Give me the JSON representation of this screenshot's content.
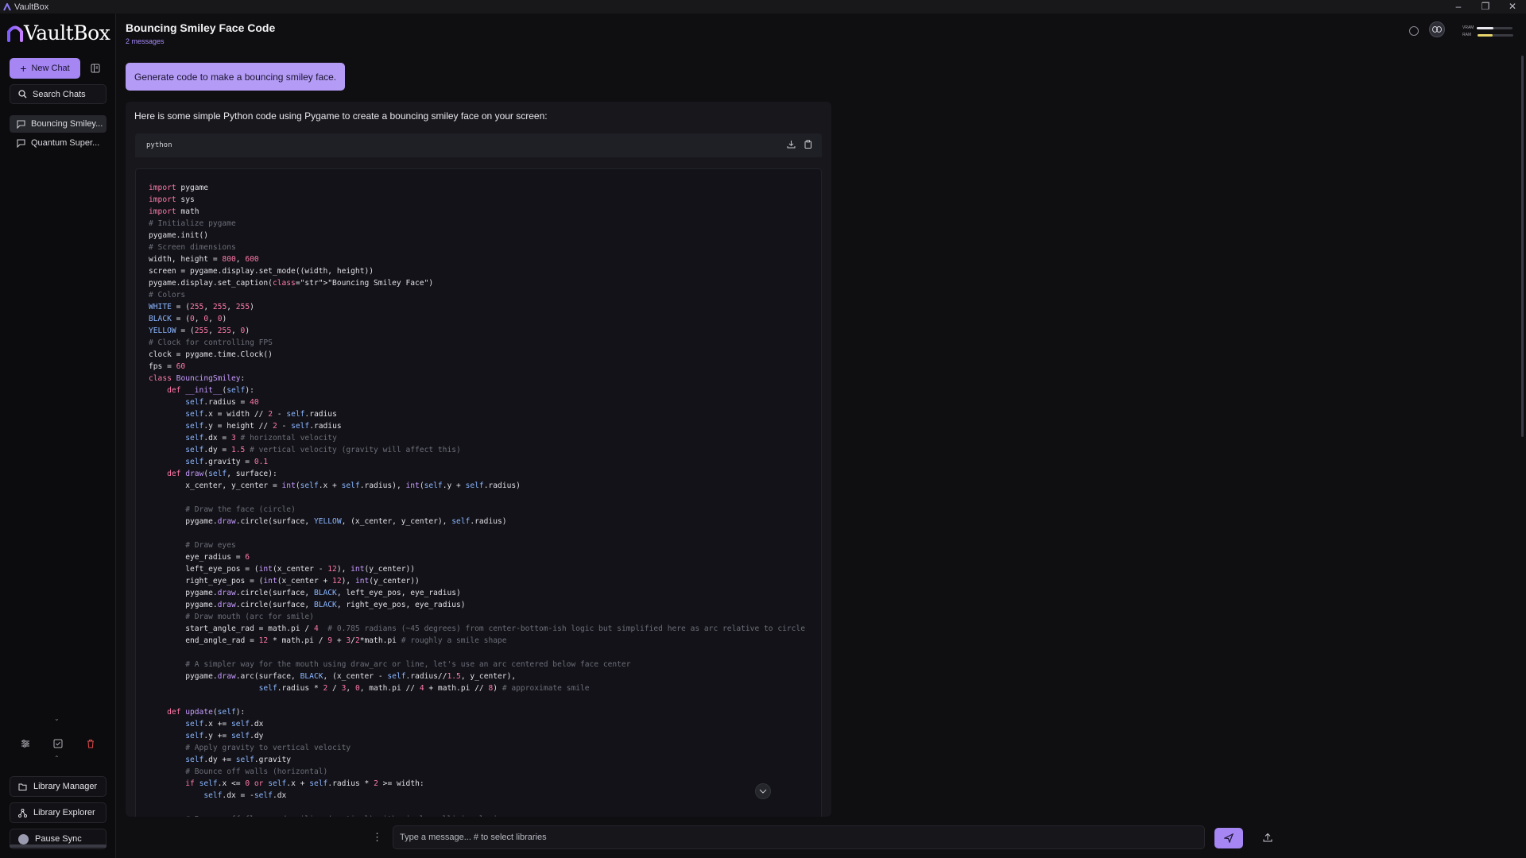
{
  "window": {
    "title": "VaultBox",
    "controls": [
      "–",
      "❐",
      "✕"
    ]
  },
  "sidebar": {
    "logo": "VaultBox",
    "new_chat": "New Chat",
    "search": "Search Chats",
    "chats": [
      {
        "label": "Bouncing Smiley...",
        "active": true
      },
      {
        "label": "Quantum Super...",
        "active": false
      }
    ],
    "buttons": {
      "library_manager": "Library Manager",
      "library_explorer": "Library Explorer",
      "pause_sync": "Pause Sync"
    }
  },
  "header": {
    "title": "Bouncing Smiley Face Code",
    "subtitle": "2 messages"
  },
  "meters": {
    "vram_label": "VRAM",
    "ram_label": "RAM",
    "vram_level": 0.45,
    "ram_level": 0.42,
    "vram_color": "#e8e8ee",
    "ram_color": "#e6d36a"
  },
  "conversation": {
    "user_message": "Generate code to make a bouncing smiley face.",
    "assistant_intro": "Here is some simple Python code using Pygame to create a bouncing smiley face on your screen:",
    "code_language": "python",
    "code_lines": [
      "import pygame",
      "import sys",
      "import math",
      "# Initialize pygame",
      "pygame.init()",
      "# Screen dimensions",
      "width, height = 800, 600",
      "screen = pygame.display.set_mode((width, height))",
      "pygame.display.set_caption(\"Bouncing Smiley Face\")",
      "# Colors",
      "WHITE = (255, 255, 255)",
      "BLACK = (0, 0, 0)",
      "YELLOW = (255, 255, 0)",
      "# Clock for controlling FPS",
      "clock = pygame.time.Clock()",
      "fps = 60",
      "class BouncingSmiley:",
      "    def __init__(self):",
      "        self.radius = 40",
      "        self.x = width // 2 - self.radius",
      "        self.y = height // 2 - self.radius",
      "        self.dx = 3 # horizontal velocity",
      "        self.dy = 1.5 # vertical velocity (gravity will affect this)",
      "        self.gravity = 0.1",
      "    def draw(self, surface):",
      "        x_center, y_center = int(self.x + self.radius), int(self.y + self.radius)",
      "",
      "        # Draw the face (circle)",
      "        pygame.draw.circle(surface, YELLOW, (x_center, y_center), self.radius)",
      "",
      "        # Draw eyes",
      "        eye_radius = 6",
      "        left_eye_pos = (int(x_center - 12), int(y_center))",
      "        right_eye_pos = (int(x_center + 12), int(y_center))",
      "        pygame.draw.circle(surface, BLACK, left_eye_pos, eye_radius)",
      "        pygame.draw.circle(surface, BLACK, right_eye_pos, eye_radius)",
      "        # Draw mouth (arc for smile)",
      "        start_angle_rad = math.pi / 4  # 0.785 radians (~45 degrees) from center-bottom-ish logic but simplified here as arc relative to circle",
      "        end_angle_rad = 12 * math.pi / 9 + 3/2*math.pi # roughly a smile shape",
      "",
      "        # A simpler way for the mouth using draw_arc or line, let's use an arc centered below face center",
      "        pygame.draw.arc(surface, BLACK, (x_center - self.radius//1.5, y_center),",
      "                        self.radius * 2 / 3, 0, math.pi // 4 + math.pi // 8) # approximate smile",
      "",
      "    def update(self):",
      "        self.x += self.dx",
      "        self.y += self.dy",
      "        # Apply gravity to vertical velocity",
      "        self.dy += self.gravity",
      "        # Bounce off walls (horizontal)",
      "        if self.x <= 0 or self.x + self.radius * 2 >= width:",
      "            self.dx = -self.dx",
      "",
      "        # Bounce off floor and ceiling (vertical) with simple collision logic"
    ]
  },
  "composer": {
    "placeholder": "Type a message... # to select libraries"
  },
  "colors": {
    "accent": "#a586f3",
    "background": "#0f0f12"
  }
}
